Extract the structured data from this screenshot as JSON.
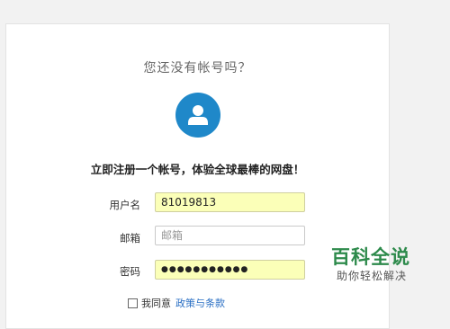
{
  "form": {
    "question": "您还没有帐号吗？",
    "avatar_icon": "user-icon",
    "slogan": "立即注册一个帐号，体验全球最棒的网盘！",
    "username_label": "用户名",
    "username_value": "81019813",
    "email_label": "邮箱",
    "email_placeholder": "邮箱",
    "password_label": "密码",
    "password_value": "●●●●●●●●●●●",
    "agree_text": "我同意",
    "agree_link": "政策与条款"
  },
  "watermark": {
    "title": "百科全说",
    "subtitle": "助你轻松解决"
  },
  "colors": {
    "accent": "#1f88c9",
    "autofill": "#fbffb8",
    "link": "#2a6fc4",
    "watermark": "#2d8a4b"
  }
}
